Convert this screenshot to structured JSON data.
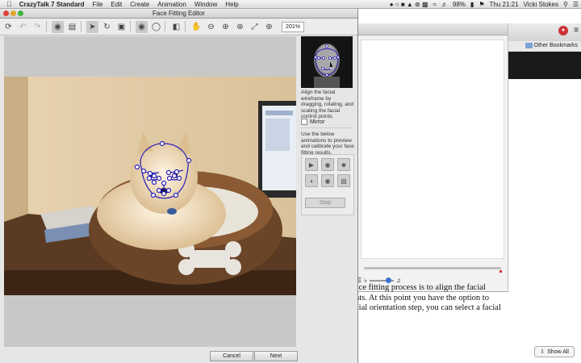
{
  "menubar": {
    "app_name": "CrazyTalk 7 Standard",
    "menus": [
      "File",
      "Edit",
      "Create",
      "Animation",
      "Window",
      "Help"
    ],
    "battery": "98%",
    "clock": "Thu 21:21",
    "user": "Vicki Stokes"
  },
  "browser": {
    "bookmark": "Other Bookmarks",
    "article_lines": [
      "ace fitting process is to align the facial",
      "nts. At this point you have the option to",
      "cial orientation step, you can select a facial"
    ],
    "show_all": "Show All"
  },
  "editor": {
    "title": "Face Fitting Editor",
    "zoom": "201%",
    "panel": {
      "instructions": "Align the facial wireframe by dragging, rotating, and scaling the facial control points.",
      "mirror_label": "Mirror",
      "preview_text": "Use the below animations to preview and calibrate your face fitting results.",
      "stop_label": "Stop"
    },
    "cancel_label": "Cancel",
    "next_label": "Next"
  },
  "colors": {
    "wireframe": "#2a1fb8",
    "control_point_fill": "#ffffff"
  }
}
